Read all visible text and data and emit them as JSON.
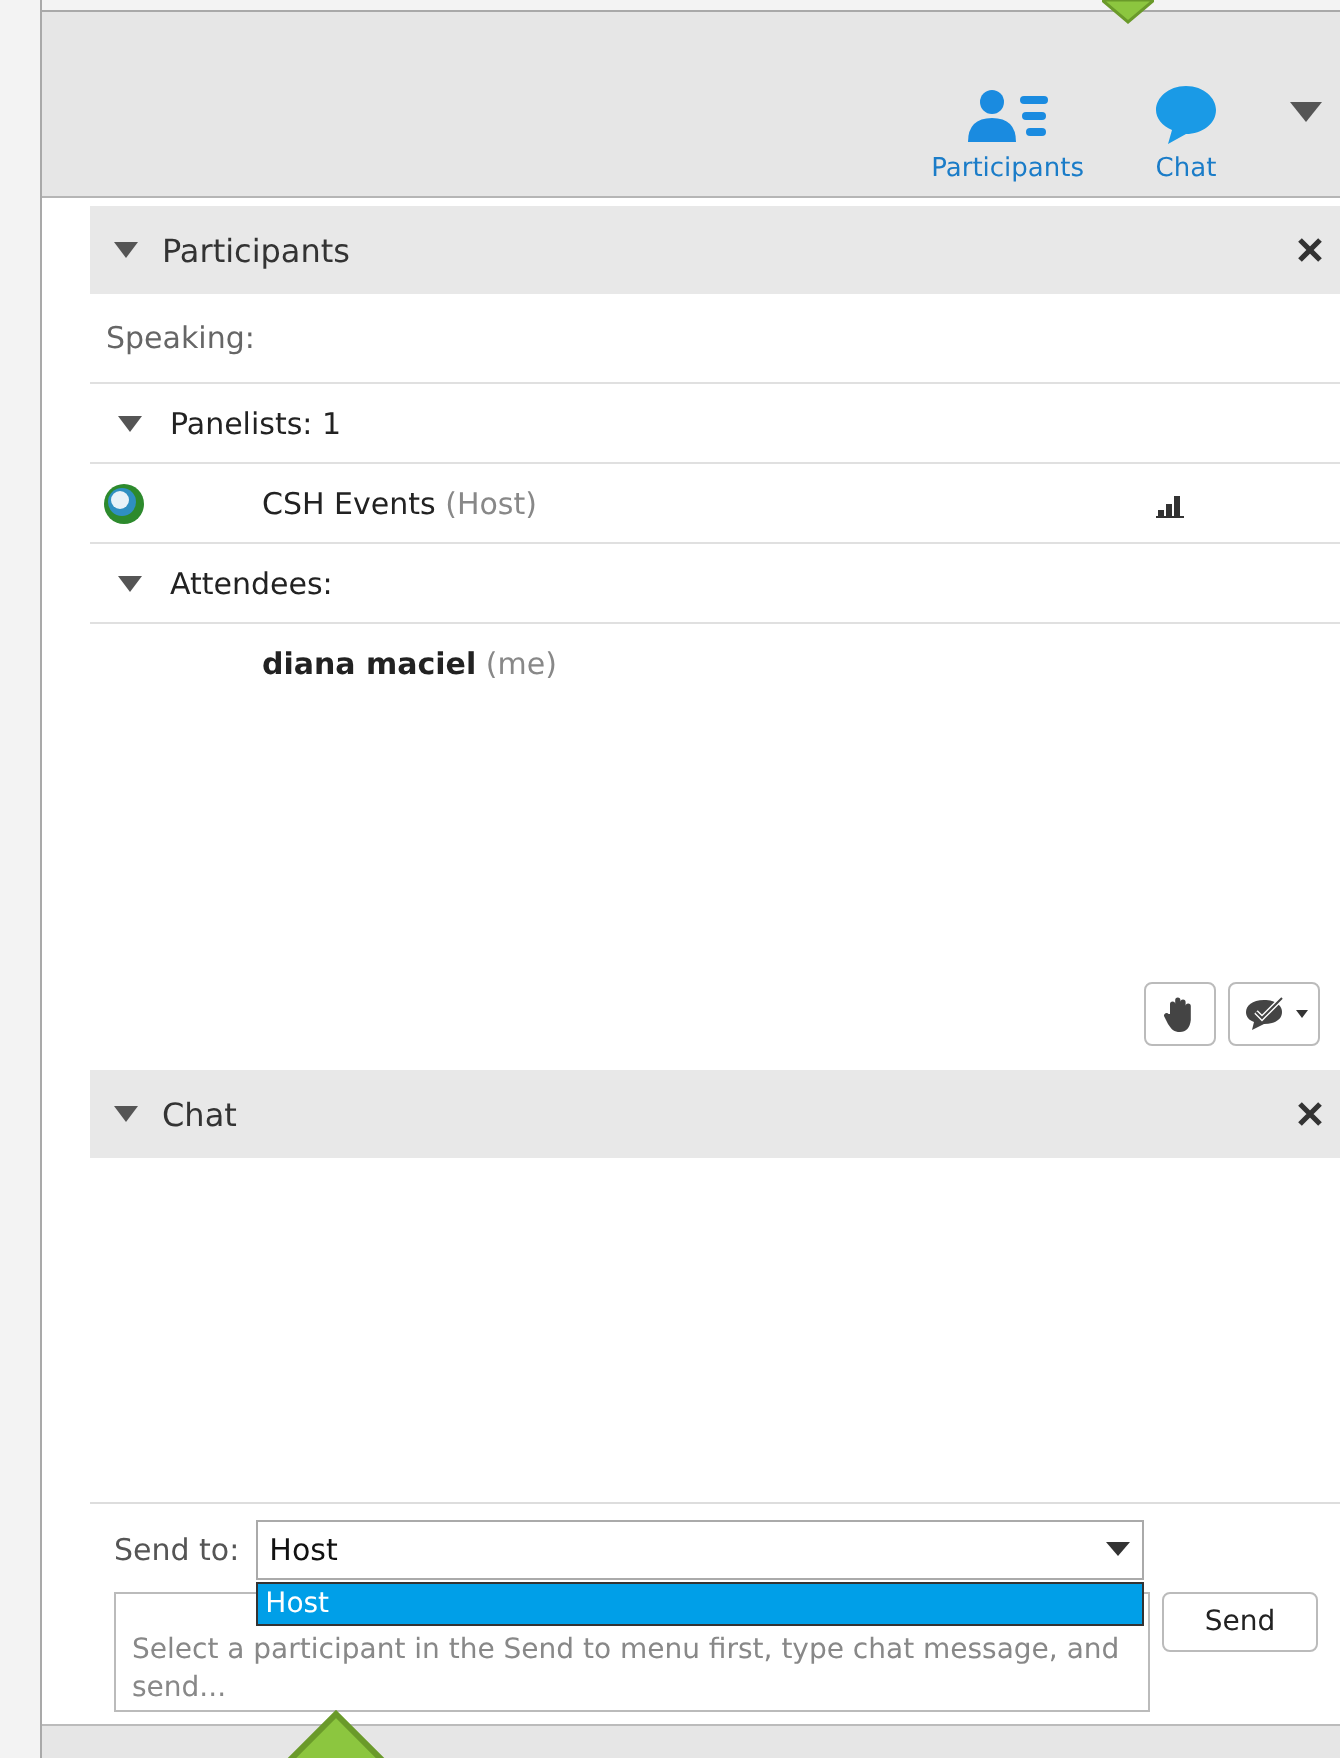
{
  "toolbar": {
    "buttons": [
      {
        "label": "Participants",
        "kind": "participants"
      },
      {
        "label": "Chat",
        "kind": "chat"
      }
    ]
  },
  "participants_panel": {
    "title": "Participants",
    "expanded": true,
    "speaking_label": "Speaking:",
    "groups": [
      {
        "label": "Panelists: 1",
        "expanded": true,
        "members": [
          {
            "name": "CSH Events",
            "role": "(Host)",
            "bold": false,
            "kind": "host"
          }
        ]
      },
      {
        "label": "Attendees:",
        "expanded": true,
        "members": [
          {
            "name": "diana maciel",
            "role": "(me)",
            "bold": true,
            "kind": "attendee"
          }
        ]
      }
    ]
  },
  "chat_panel": {
    "title": "Chat",
    "expanded": true,
    "send_to_label": "Send to:",
    "send_to_value": "Host",
    "dropdown_options": [
      {
        "label": "Host",
        "selected": true
      }
    ],
    "placeholder": "Select a participant in the Send to menu first, type chat message, and send...",
    "send_button": "Send"
  }
}
